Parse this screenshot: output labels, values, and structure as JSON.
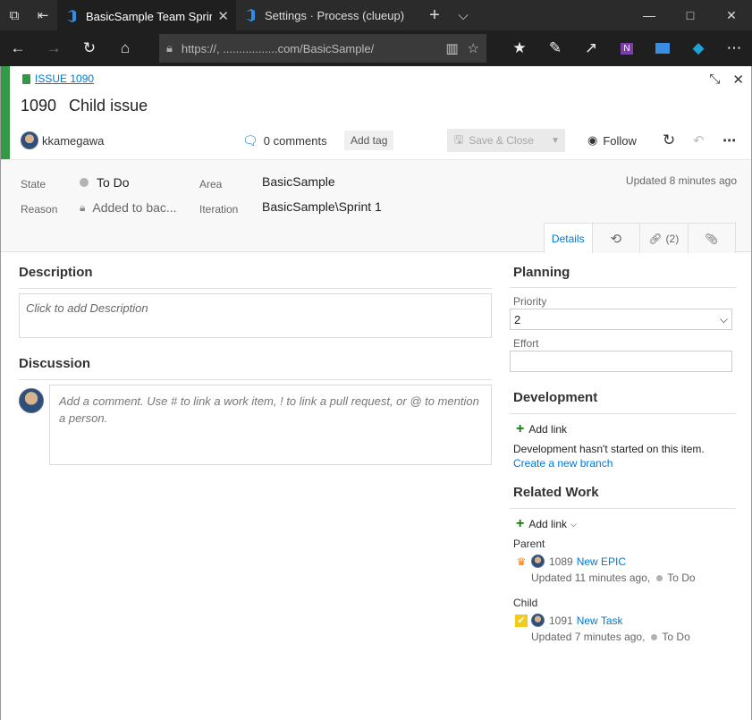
{
  "browser": {
    "tabs": [
      {
        "label": "BasicSample Team Sprir",
        "active": true
      },
      {
        "label": "Settings · Process (clueup) -",
        "active": false
      }
    ],
    "address": "https://, .................com/BasicSample/"
  },
  "work_item": {
    "type_link": "ISSUE 1090",
    "id": "1090",
    "title": "Child issue",
    "assigned_to": "kkamegawa",
    "comments": "0 comments",
    "add_tag": "Add tag",
    "save_close": "Save & Close",
    "follow": "Follow",
    "accent_color": "#339947"
  },
  "fields": {
    "state_label": "State",
    "state_value": "To Do",
    "reason_label": "Reason",
    "reason_value": "Added to bac...",
    "area_label": "Area",
    "area_value": "BasicSample",
    "iteration_label": "Iteration",
    "iteration_value": "BasicSample\\Sprint 1",
    "updated": "Updated 8 minutes ago"
  },
  "tabs": {
    "details": "Details",
    "links": "(2)"
  },
  "description": {
    "title": "Description",
    "placeholder": "Click to add Description"
  },
  "discussion": {
    "title": "Discussion",
    "placeholder": "Add a comment. Use # to link a work item, ! to link a pull request, or @ to mention a person."
  },
  "planning": {
    "title": "Planning",
    "priority_label": "Priority",
    "priority_value": "2",
    "effort_label": "Effort"
  },
  "development": {
    "title": "Development",
    "add_link": "Add link",
    "note": "Development hasn't started on this item.",
    "create_branch": "Create a new branch"
  },
  "related_work": {
    "title": "Related Work",
    "add_link": "Add link",
    "parent_label": "Parent",
    "parent": {
      "id": "1089",
      "title": "New EPIC",
      "updated": "Updated 11 minutes ago,",
      "state": "To Do"
    },
    "child_label": "Child",
    "child": {
      "id": "1091",
      "title": "New Task",
      "updated": "Updated 7 minutes ago,",
      "state": "To Do"
    }
  }
}
